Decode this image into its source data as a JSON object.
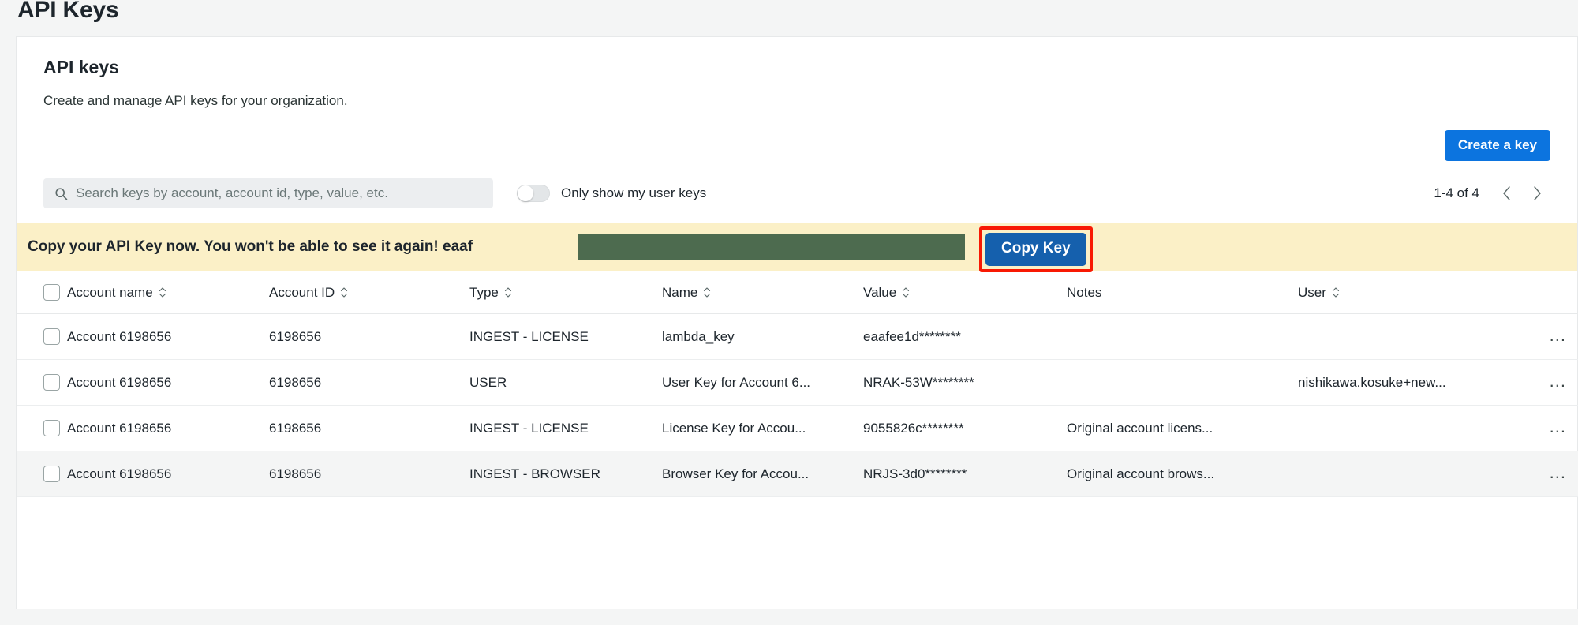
{
  "page": {
    "title": "API Keys"
  },
  "card": {
    "title": "API keys",
    "subtitle": "Create and manage API keys for your organization."
  },
  "actions": {
    "create_key_label": "Create a key"
  },
  "search": {
    "placeholder": "Search keys by account, account id, type, value, etc.",
    "value": ""
  },
  "filters": {
    "only_my_keys_label": "Only show my user keys",
    "only_my_keys_on": false
  },
  "pagination": {
    "range": "1-4 of 4",
    "prev_label": "Previous page",
    "next_label": "Next page"
  },
  "alert": {
    "message": "Copy your API Key now. You won't be able to see it again! eaaf",
    "redacted_value": "",
    "copy_button_label": "Copy Key",
    "background_color": "#fbf0c7",
    "redaction_color": "#4d6b4f",
    "highlight_color": "#f81903",
    "copy_button_color": "#1560ad"
  },
  "table": {
    "columns": [
      {
        "label": "Account name",
        "sortable": true
      },
      {
        "label": "Account ID",
        "sortable": true
      },
      {
        "label": "Type",
        "sortable": true
      },
      {
        "label": "Name",
        "sortable": true
      },
      {
        "label": "Value",
        "sortable": true
      },
      {
        "label": "Notes",
        "sortable": false
      },
      {
        "label": "User",
        "sortable": true
      }
    ],
    "rows": [
      {
        "account_name": "Account 6198656",
        "account_id": "6198656",
        "type": "INGEST - LICENSE",
        "name": "lambda_key",
        "value": "eaafee1d********",
        "notes": "",
        "user": "",
        "highlighted": false
      },
      {
        "account_name": "Account 6198656",
        "account_id": "6198656",
        "type": "USER",
        "name": "User Key for Account 6...",
        "value": "NRAK-53W********",
        "notes": "",
        "user": "nishikawa.kosuke+new...",
        "highlighted": false
      },
      {
        "account_name": "Account 6198656",
        "account_id": "6198656",
        "type": "INGEST - LICENSE",
        "name": "License Key for Accou...",
        "value": "9055826c********",
        "notes": "Original account licens...",
        "user": "",
        "highlighted": false
      },
      {
        "account_name": "Account 6198656",
        "account_id": "6198656",
        "type": "INGEST - BROWSER",
        "name": "Browser Key for Accou...",
        "value": "NRJS-3d0********",
        "notes": "Original account brows...",
        "user": "",
        "highlighted": true
      }
    ],
    "row_menu_label": "..."
  },
  "theme": {
    "accent": "#0c74df",
    "page_background": "#f4f5f5",
    "card_background": "#ffffff",
    "text": "#1d252c"
  }
}
